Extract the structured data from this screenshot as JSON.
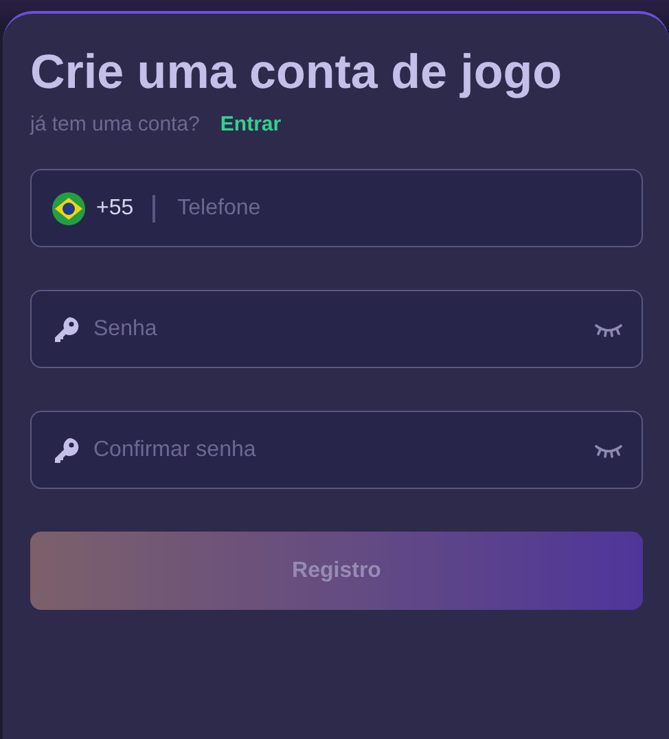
{
  "title": "Crie uma conta de jogo",
  "subtitle": {
    "text": "já tem uma conta?",
    "link": "Entrar"
  },
  "fields": [
    {
      "kind": "phone",
      "prefix": "+55",
      "placeholder": "Telefone"
    },
    {
      "kind": "password",
      "placeholder": "Senha"
    },
    {
      "kind": "password",
      "placeholder": "Confirmar senha"
    }
  ],
  "submit": {
    "label": "Registro",
    "disabled": true
  }
}
